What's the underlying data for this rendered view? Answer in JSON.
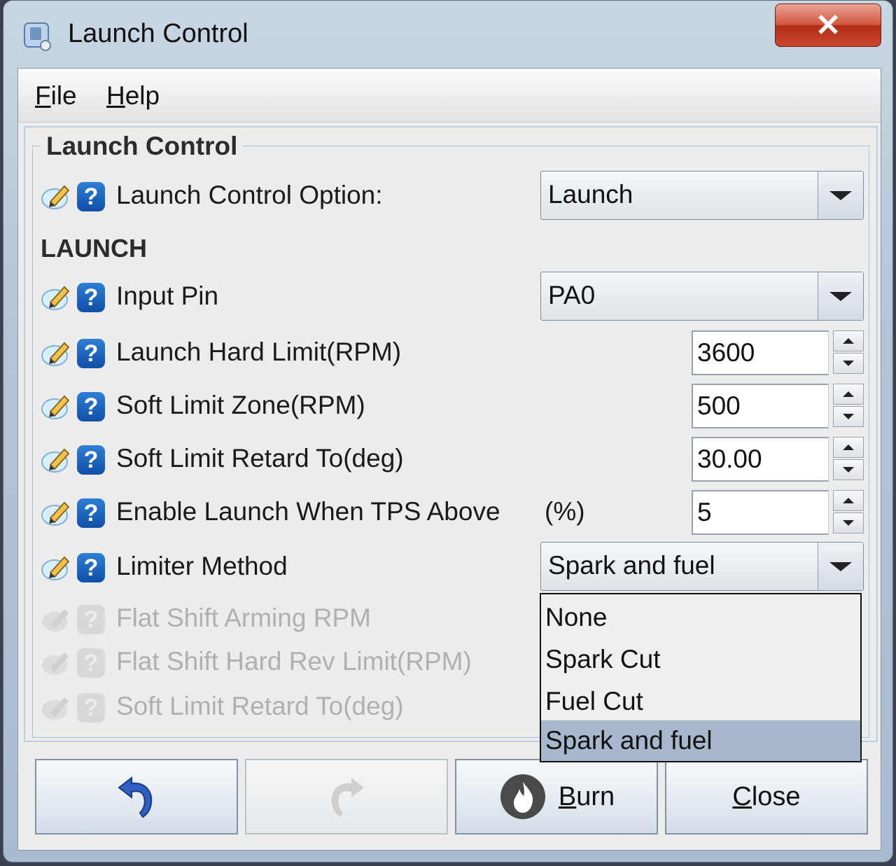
{
  "window": {
    "title": "Launch Control",
    "close_glyph": "✕"
  },
  "menu": [
    {
      "label": "File",
      "mnemonic": "F",
      "rest": "ile"
    },
    {
      "label": "Help",
      "mnemonic": "H",
      "rest": "elp"
    }
  ],
  "group": {
    "title": "Launch Control"
  },
  "fields": {
    "launch_option": {
      "label": "Launch Control Option:",
      "value": "Launch"
    },
    "section_launch": "LAUNCH",
    "input_pin": {
      "label": "Input Pin",
      "value": "PA0"
    },
    "hard_limit": {
      "label": "Launch Hard Limit(RPM)",
      "value": "3600"
    },
    "soft_zone": {
      "label": "Soft Limit Zone(RPM)",
      "value": "500"
    },
    "soft_retard": {
      "label": "Soft Limit Retard To(deg)",
      "value": "30.00"
    },
    "tps_above": {
      "label": "Enable Launch When TPS Above",
      "unit": "(%)",
      "value": "5"
    },
    "limiter_method": {
      "label": "Limiter Method",
      "value": "Spark and fuel"
    },
    "flat_arming": {
      "label": "Flat Shift Arming RPM"
    },
    "flat_hard": {
      "label": "Flat Shift Hard Rev Limit(RPM)"
    },
    "flat_retard": {
      "label": "Soft Limit Retard To(deg)"
    }
  },
  "dropdown": {
    "options": [
      "None",
      "Spark Cut",
      "Fuel Cut",
      "Spark and fuel"
    ],
    "selected": "Spark and fuel"
  },
  "buttons": {
    "undo_icon": "undo-arrow-icon",
    "redo_icon": "redo-arrow-icon",
    "burn": {
      "mnemonic": "B",
      "rest": "urn",
      "icon": "flame-icon"
    },
    "close": {
      "mnemonic": "C",
      "rest": "lose"
    }
  },
  "colors": {
    "selection": "#a8b8cc",
    "help_icon": "#1b63b8",
    "close_button": "#c9492f"
  }
}
